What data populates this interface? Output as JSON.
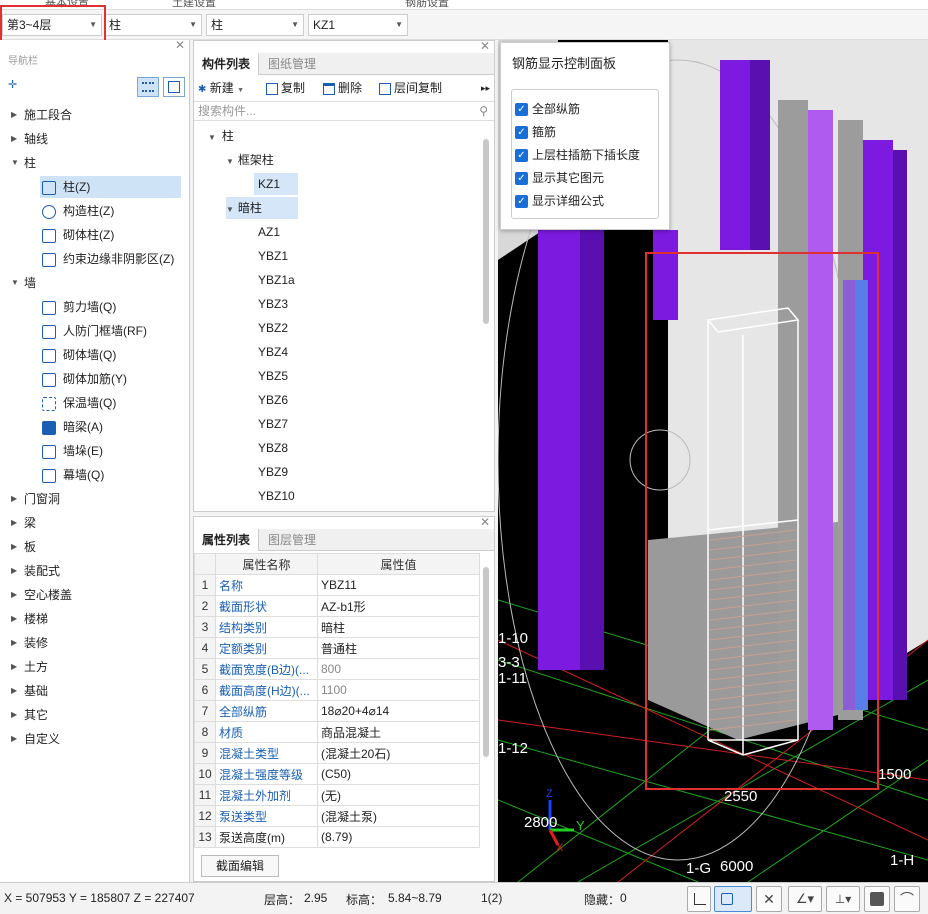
{
  "top_tabs": [
    "基本设置",
    "土建设置",
    "钢筋设置"
  ],
  "selectors": {
    "floor": "第3~4层",
    "category": "柱",
    "type": "柱",
    "component": "KZ1"
  },
  "nav": {
    "title": "导航栏",
    "groups": [
      {
        "label": "施工段合",
        "expanded": false
      },
      {
        "label": "轴线",
        "expanded": false
      },
      {
        "label": "柱",
        "expanded": true
      },
      {
        "label": "墙",
        "expanded": true
      },
      {
        "label": "门窗洞",
        "expanded": false
      },
      {
        "label": "梁",
        "expanded": false
      },
      {
        "label": "板",
        "expanded": false
      },
      {
        "label": "装配式",
        "expanded": false
      },
      {
        "label": "空心楼盖",
        "expanded": false
      },
      {
        "label": "楼梯",
        "expanded": false
      },
      {
        "label": "装修",
        "expanded": false
      },
      {
        "label": "土方",
        "expanded": false
      },
      {
        "label": "基础",
        "expanded": false
      },
      {
        "label": "其它",
        "expanded": false
      },
      {
        "label": "自定义",
        "expanded": false
      }
    ],
    "column_items": [
      "柱(Z)",
      "构造柱(Z)",
      "砌体柱(Z)",
      "约束边缘非阴影区(Z)"
    ],
    "wall_items": [
      "剪力墙(Q)",
      "人防门框墙(RF)",
      "砌体墙(Q)",
      "砌体加筋(Y)",
      "保温墙(Q)",
      "暗梁(A)",
      "墙垛(E)",
      "幕墙(Q)"
    ]
  },
  "component_panel": {
    "tabs": [
      "构件列表",
      "图纸管理"
    ],
    "toolbar": {
      "new": "新建",
      "copy": "复制",
      "delete": "删除",
      "floor_copy": "层间复制"
    },
    "search_placeholder": "搜索构件...",
    "tree_root": "柱",
    "frame_column": "框架柱",
    "frame_items": [
      "KZ1"
    ],
    "hidden_column": "暗柱",
    "hidden_items": [
      "AZ1",
      "YBZ1",
      "YBZ1a",
      "YBZ3",
      "YBZ2",
      "YBZ4",
      "YBZ5",
      "YBZ6",
      "YBZ7",
      "YBZ8",
      "YBZ9",
      "YBZ10"
    ]
  },
  "property_panel": {
    "tabs": [
      "属性列表",
      "图层管理"
    ],
    "headers": [
      "属性名称",
      "属性值"
    ],
    "rows": [
      {
        "n": "1",
        "name": "名称",
        "value": "YBZ11"
      },
      {
        "n": "2",
        "name": "截面形状",
        "value": "AZ-b1形"
      },
      {
        "n": "3",
        "name": "结构类别",
        "value": "暗柱"
      },
      {
        "n": "4",
        "name": "定额类别",
        "value": "普通柱"
      },
      {
        "n": "5",
        "name": "截面宽度(B边)(...",
        "value": "800"
      },
      {
        "n": "6",
        "name": "截面高度(H边)(...",
        "value": "1100"
      },
      {
        "n": "7",
        "name": "全部纵筋",
        "value": "18⌀20+4⌀14"
      },
      {
        "n": "8",
        "name": "材质",
        "value": "商品混凝土"
      },
      {
        "n": "9",
        "name": "混凝土类型",
        "value": "(混凝土20石)"
      },
      {
        "n": "10",
        "name": "混凝土强度等级",
        "value": "(C50)"
      },
      {
        "n": "11",
        "name": "混凝土外加剂",
        "value": "(无)"
      },
      {
        "n": "12",
        "name": "泵送类型",
        "value": "(混凝土泵)"
      },
      {
        "n": "13",
        "name": "泵送高度(m)",
        "value": "(8.79)"
      }
    ],
    "edit_button": "截面编辑"
  },
  "rebar_panel": {
    "title": "钢筋显示控制面板",
    "options": [
      "全部纵筋",
      "箍筋",
      "上层柱插筋下插长度",
      "显示其它图元",
      "显示详细公式"
    ]
  },
  "view_labels": {
    "dim1": "2550",
    "dim2": "1500",
    "dim3": "2800",
    "dim4": "6000",
    "axis1": "1-G",
    "axis2": "1-H",
    "axis3": "1-10",
    "axis4": "3-3",
    "axis5": "1-11",
    "axis6": "1-12",
    "axis_y": "Y",
    "axis_x": "X",
    "axis_z": "Z"
  },
  "status": {
    "coords": "X = 507953 Y = 185807 Z = 227407",
    "floor_height_label": "层高：",
    "floor_height": "2.95",
    "elevation_label": "标高：",
    "elevation": "5.84~8.79",
    "count": "1(2)",
    "hidden_label": "隐藏：",
    "hidden": "0"
  }
}
